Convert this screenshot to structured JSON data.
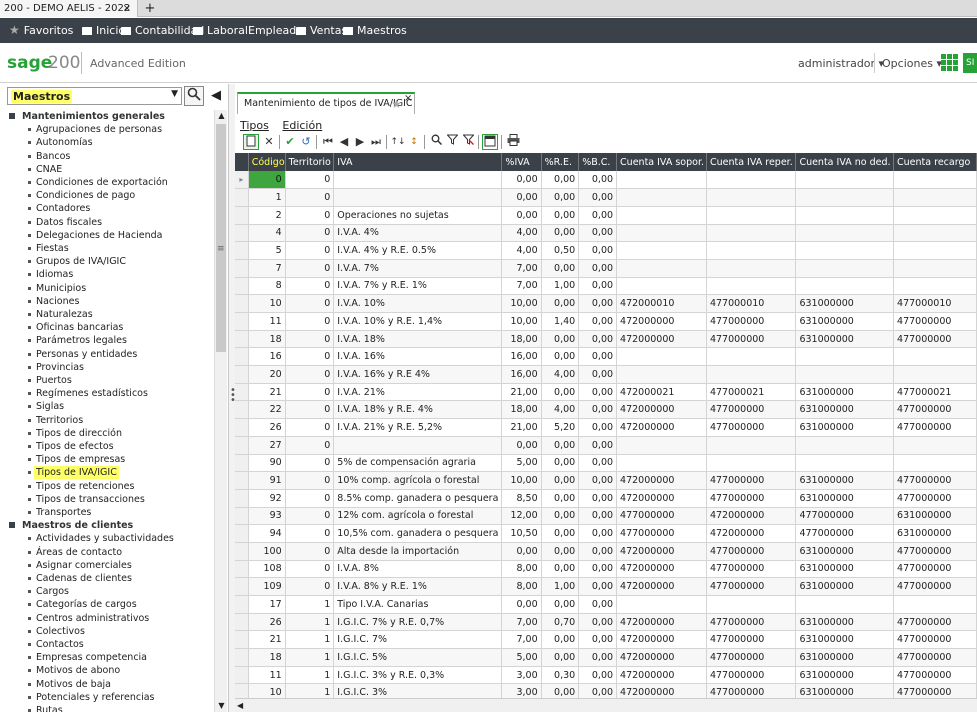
{
  "browser": {
    "tab_title": "200 - DEMO AELIS - 2022",
    "tab_close": "×",
    "new_tab": "+"
  },
  "favbar": {
    "favoritos": "Favoritos",
    "items": [
      "Inicio",
      "Contabilidad",
      "Laboral",
      "Empleado",
      "Ventas",
      "Maestros"
    ]
  },
  "header": {
    "brand": "sage",
    "version": "200",
    "edition": "Advanced Edition",
    "user": "administrador ▾",
    "options": "Opciones ▾",
    "green_button": "SI"
  },
  "sidebar": {
    "combo_value": "Maestros",
    "groups": [
      {
        "title": "Mantenimientos generales",
        "items": [
          "Agrupaciones de personas",
          "Autonomías",
          "Bancos",
          "CNAE",
          "Condiciones de exportación",
          "Condiciones de pago",
          "Contadores",
          "Datos fiscales",
          "Delegaciones de Hacienda",
          "Fiestas",
          "Grupos de IVA/IGIC",
          "Idiomas",
          "Municipios",
          "Naciones",
          "Naturalezas",
          "Oficinas bancarias",
          "Parámetros legales",
          "Personas y entidades",
          "Provincias",
          "Puertos",
          "Regímenes estadísticos",
          "Siglas",
          "Territorios",
          "Tipos de dirección",
          "Tipos de efectos",
          "Tipos de empresas",
          "Tipos de IVA/IGIC",
          "Tipos de retenciones",
          "Tipos de transacciones",
          "Transportes"
        ]
      },
      {
        "title": "Maestros de clientes",
        "items": [
          "Actividades y subactividades",
          "Áreas de contacto",
          "Asignar comerciales",
          "Cadenas de clientes",
          "Cargos",
          "Categorías de cargos",
          "Centros administrativos",
          "Colectivos",
          "Contactos",
          "Empresas competencia",
          "Motivos de abono",
          "Motivos de baja",
          "Potenciales y referencias",
          "Rutas"
        ]
      }
    ],
    "selected_item": "Tipos de IVA/IGIC"
  },
  "document": {
    "tab_title": "Mantenimiento de tipos de IVA/IGIC",
    "tab_close": "×",
    "menu": [
      "Tipos",
      "Edición"
    ]
  },
  "grid": {
    "columns": [
      "Código",
      "Territorio",
      "IVA",
      "%IVA",
      "%R.E.",
      "%B.C.",
      "Cuenta IVA sopor.",
      "Cuenta IVA reper.",
      "Cuenta IVA no ded.",
      "Cuenta recargo"
    ],
    "rows": [
      [
        "0",
        "0",
        "",
        "0,00",
        "0,00",
        "0,00",
        "",
        "",
        "",
        ""
      ],
      [
        "1",
        "0",
        "",
        "0,00",
        "0,00",
        "0,00",
        "",
        "",
        "",
        ""
      ],
      [
        "2",
        "0",
        "Operaciones no sujetas",
        "0,00",
        "0,00",
        "0,00",
        "",
        "",
        "",
        ""
      ],
      [
        "4",
        "0",
        "I.V.A. 4%",
        "4,00",
        "0,00",
        "0,00",
        "",
        "",
        "",
        ""
      ],
      [
        "5",
        "0",
        "I.V.A. 4% y R.E. 0.5%",
        "4,00",
        "0,50",
        "0,00",
        "",
        "",
        "",
        ""
      ],
      [
        "7",
        "0",
        "I.V.A. 7%",
        "7,00",
        "0,00",
        "0,00",
        "",
        "",
        "",
        ""
      ],
      [
        "8",
        "0",
        "I.V.A. 7% y R.E. 1%",
        "7,00",
        "1,00",
        "0,00",
        "",
        "",
        "",
        ""
      ],
      [
        "10",
        "0",
        "I.V.A. 10%",
        "10,00",
        "0,00",
        "0,00",
        "472000010",
        "477000010",
        "631000000",
        "477000010"
      ],
      [
        "11",
        "0",
        "I.V.A. 10% y R.E. 1,4%",
        "10,00",
        "1,40",
        "0,00",
        "472000000",
        "477000000",
        "631000000",
        "477000000"
      ],
      [
        "18",
        "0",
        "I.V.A. 18%",
        "18,00",
        "0,00",
        "0,00",
        "472000000",
        "477000000",
        "631000000",
        "477000000"
      ],
      [
        "16",
        "0",
        "I.V.A. 16%",
        "16,00",
        "0,00",
        "0,00",
        "",
        "",
        "",
        ""
      ],
      [
        "20",
        "0",
        "I.V.A. 16% y R.E 4%",
        "16,00",
        "4,00",
        "0,00",
        "",
        "",
        "",
        ""
      ],
      [
        "21",
        "0",
        "I.V.A. 21%",
        "21,00",
        "0,00",
        "0,00",
        "472000021",
        "477000021",
        "631000000",
        "477000021"
      ],
      [
        "22",
        "0",
        "I.V.A. 18% y R.E. 4%",
        "18,00",
        "4,00",
        "0,00",
        "472000000",
        "477000000",
        "631000000",
        "477000000"
      ],
      [
        "26",
        "0",
        "I.V.A. 21% y R.E. 5,2%",
        "21,00",
        "5,20",
        "0,00",
        "472000000",
        "477000000",
        "631000000",
        "477000000"
      ],
      [
        "27",
        "0",
        "",
        "0,00",
        "0,00",
        "0,00",
        "",
        "",
        "",
        ""
      ],
      [
        "90",
        "0",
        "5% de compensación agraria",
        "5,00",
        "0,00",
        "0,00",
        "",
        "",
        "",
        ""
      ],
      [
        "91",
        "0",
        "10% comp. agrícola o forestal",
        "10,00",
        "0,00",
        "0,00",
        "472000000",
        "477000000",
        "631000000",
        "477000000"
      ],
      [
        "92",
        "0",
        "8.5% comp. ganadera o pesquera",
        "8,50",
        "0,00",
        "0,00",
        "472000000",
        "477000000",
        "631000000",
        "477000000"
      ],
      [
        "93",
        "0",
        "12% com. agrícola o forestal",
        "12,00",
        "0,00",
        "0,00",
        "477000000",
        "472000000",
        "477000000",
        "631000000"
      ],
      [
        "94",
        "0",
        "10,5% com. ganadera o pesquera",
        "10,50",
        "0,00",
        "0,00",
        "477000000",
        "472000000",
        "477000000",
        "631000000"
      ],
      [
        "100",
        "0",
        "Alta desde la importación",
        "0,00",
        "0,00",
        "0,00",
        "472000000",
        "477000000",
        "631000000",
        "477000000"
      ],
      [
        "108",
        "0",
        "I.V.A. 8%",
        "8,00",
        "0,00",
        "0,00",
        "472000000",
        "477000000",
        "631000000",
        "477000000"
      ],
      [
        "109",
        "0",
        "I.V.A. 8% y R.E. 1%",
        "8,00",
        "1,00",
        "0,00",
        "472000000",
        "477000000",
        "631000000",
        "477000000"
      ],
      [
        "17",
        "1",
        "Tipo I.V.A. Canarias",
        "0,00",
        "0,00",
        "0,00",
        "",
        "",
        "",
        ""
      ],
      [
        "26",
        "1",
        "I.G.I.C. 7% y R.E. 0,7%",
        "7,00",
        "0,70",
        "0,00",
        "472000000",
        "477000000",
        "631000000",
        "477000000"
      ],
      [
        "21",
        "1",
        "I.G.I.C. 7%",
        "7,00",
        "0,00",
        "0,00",
        "472000000",
        "477000000",
        "631000000",
        "477000000"
      ],
      [
        "18",
        "1",
        "I.G.I.C. 5%",
        "5,00",
        "0,00",
        "0,00",
        "472000000",
        "477000000",
        "631000000",
        "477000000"
      ],
      [
        "11",
        "1",
        "I.G.I.C. 3% y R.E. 0,3%",
        "3,00",
        "0,30",
        "0,00",
        "472000000",
        "477000000",
        "631000000",
        "477000000"
      ],
      [
        "10",
        "1",
        "I.G.I.C. 3%",
        "3,00",
        "0,00",
        "0,00",
        "472000000",
        "477000000",
        "631000000",
        "477000000"
      ]
    ]
  },
  "colors": {
    "accent": "#26a236",
    "dark_bar": "#3b4148",
    "highlight": "#ffff66"
  }
}
